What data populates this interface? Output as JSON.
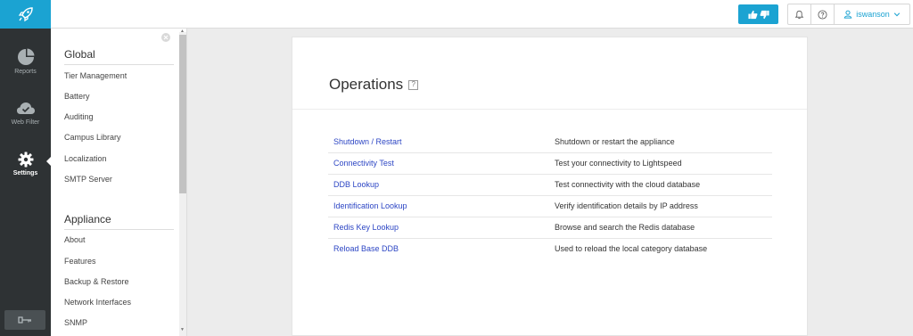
{
  "topbar": {
    "username": "iswanson"
  },
  "rail": {
    "items": [
      {
        "label": "Reports",
        "icon": "pie-chart-icon"
      },
      {
        "label": "Web Filter",
        "icon": "cloud-check-icon"
      },
      {
        "label": "Settings",
        "icon": "gear-icon"
      }
    ]
  },
  "sidebar": {
    "sections": [
      {
        "heading": "Global",
        "items": [
          "Tier Management",
          "Battery",
          "Auditing",
          "Campus Library",
          "Localization",
          "SMTP Server"
        ]
      },
      {
        "heading": "Appliance",
        "items": [
          "About",
          "Features",
          "Backup & Restore",
          "Network Interfaces",
          "SNMP"
        ]
      }
    ]
  },
  "main": {
    "title": "Operations",
    "help_glyph": "?",
    "operations": [
      {
        "name": "Shutdown / Restart",
        "description": "Shutdown or restart the appliance"
      },
      {
        "name": "Connectivity Test",
        "description": "Test your connectivity to Lightspeed"
      },
      {
        "name": "DDB Lookup",
        "description": "Test connectivity with the cloud database"
      },
      {
        "name": "Identification Lookup",
        "description": "Verify identification details by IP address"
      },
      {
        "name": "Redis Key Lookup",
        "description": "Browse and search the Redis database"
      },
      {
        "name": "Reload Base DDB",
        "description": "Used to reload the local category database"
      }
    ]
  },
  "colors": {
    "brand": "#1ba3d2",
    "rail_bg": "#2e3234",
    "link": "#2d46c4"
  }
}
